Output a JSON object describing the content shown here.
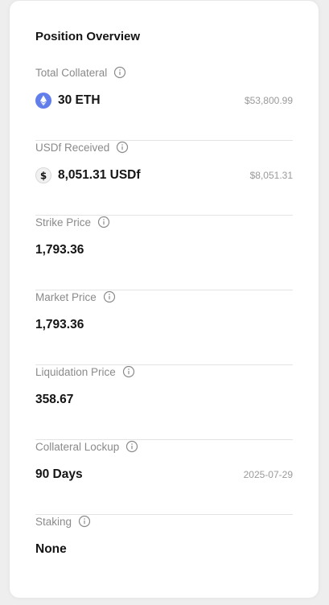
{
  "card": {
    "title": "Position Overview",
    "sections": [
      {
        "label": "Total Collateral",
        "value": "30 ETH",
        "secondary": "$53,800.99",
        "icon": "ethereum-icon"
      },
      {
        "label": "USDf Received",
        "value": "8,051.31 USDf",
        "secondary": "$8,051.31",
        "icon": "usdf-icon"
      },
      {
        "label": "Strike Price",
        "value": "1,793.36"
      },
      {
        "label": "Market Price",
        "value": "1,793.36"
      },
      {
        "label": "Liquidation Price",
        "value": "358.67"
      },
      {
        "label": "Collateral Lockup",
        "value": "90 Days",
        "secondary": "2025-07-29"
      },
      {
        "label": "Staking",
        "value": "None"
      }
    ]
  },
  "colors": {
    "ethereum": "#627eea",
    "text_primary": "#141414",
    "text_secondary": "#8a8a8a",
    "divider": "#e3e3e3"
  }
}
